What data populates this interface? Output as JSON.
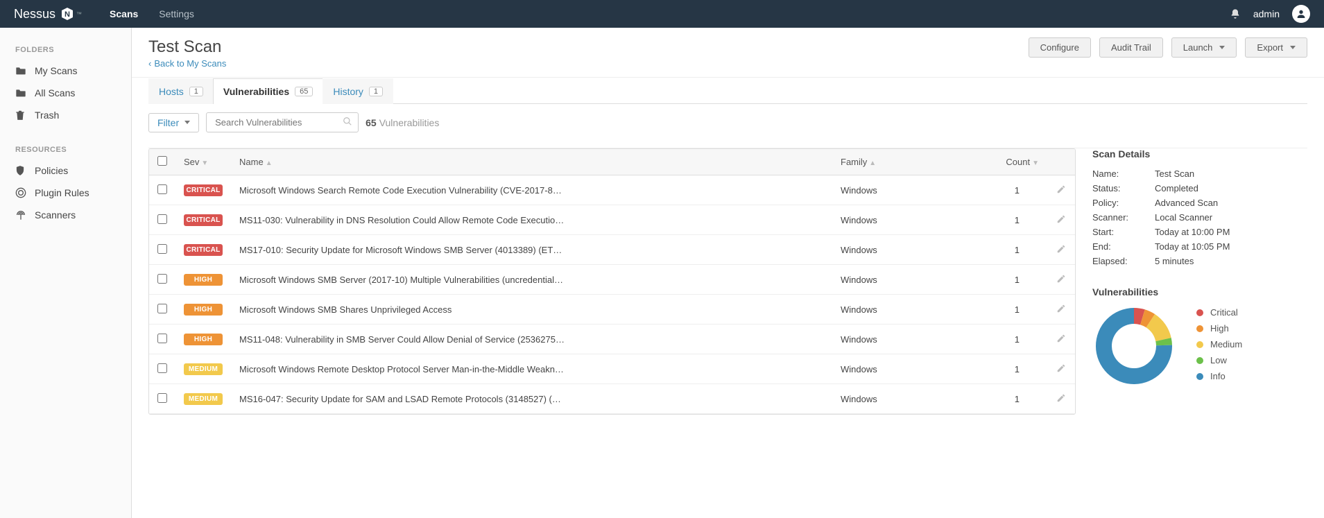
{
  "navbar": {
    "brand": "Nessus",
    "links": [
      {
        "label": "Scans",
        "active": true
      },
      {
        "label": "Settings",
        "active": false
      }
    ],
    "username": "admin"
  },
  "sidebar": {
    "folders_heading": "FOLDERS",
    "resources_heading": "RESOURCES",
    "folders": [
      {
        "label": "My Scans",
        "icon": "folder"
      },
      {
        "label": "All Scans",
        "icon": "folder"
      },
      {
        "label": "Trash",
        "icon": "trash"
      }
    ],
    "resources": [
      {
        "label": "Policies",
        "icon": "shield"
      },
      {
        "label": "Plugin Rules",
        "icon": "plugin"
      },
      {
        "label": "Scanners",
        "icon": "scanner"
      }
    ]
  },
  "page": {
    "title": "Test Scan",
    "back_label": "Back to My Scans",
    "buttons": {
      "configure": "Configure",
      "audit": "Audit Trail",
      "launch": "Launch",
      "export": "Export"
    }
  },
  "tabs": [
    {
      "label": "Hosts",
      "count": "1",
      "active": false
    },
    {
      "label": "Vulnerabilities",
      "count": "65",
      "active": true
    },
    {
      "label": "History",
      "count": "1",
      "active": false
    }
  ],
  "filters": {
    "filter_label": "Filter",
    "search_placeholder": "Search Vulnerabilities",
    "result_count_num": "65",
    "result_count_label": "Vulnerabilities"
  },
  "columns": {
    "sev": "Sev",
    "name": "Name",
    "family": "Family",
    "count": "Count"
  },
  "rows": [
    {
      "sev": "CRITICAL",
      "sev_class": "sev-critical",
      "name": "Microsoft Windows Search Remote Code Execution Vulnerability (CVE-2017-8…",
      "family": "Windows",
      "count": "1"
    },
    {
      "sev": "CRITICAL",
      "sev_class": "sev-critical",
      "name": "MS11-030: Vulnerability in DNS Resolution Could Allow Remote Code Executio…",
      "family": "Windows",
      "count": "1"
    },
    {
      "sev": "CRITICAL",
      "sev_class": "sev-critical",
      "name": "MS17-010: Security Update for Microsoft Windows SMB Server (4013389) (ET…",
      "family": "Windows",
      "count": "1"
    },
    {
      "sev": "HIGH",
      "sev_class": "sev-high",
      "name": "Microsoft Windows SMB Server (2017-10) Multiple Vulnerabilities (uncredential…",
      "family": "Windows",
      "count": "1"
    },
    {
      "sev": "HIGH",
      "sev_class": "sev-high",
      "name": "Microsoft Windows SMB Shares Unprivileged Access",
      "family": "Windows",
      "count": "1"
    },
    {
      "sev": "HIGH",
      "sev_class": "sev-high",
      "name": "MS11-048: Vulnerability in SMB Server Could Allow Denial of Service (2536275…",
      "family": "Windows",
      "count": "1"
    },
    {
      "sev": "MEDIUM",
      "sev_class": "sev-medium",
      "name": "Microsoft Windows Remote Desktop Protocol Server Man-in-the-Middle Weakn…",
      "family": "Windows",
      "count": "1"
    },
    {
      "sev": "MEDIUM",
      "sev_class": "sev-medium",
      "name": "MS16-047: Security Update for SAM and LSAD Remote Protocols (3148527) (…",
      "family": "Windows",
      "count": "1"
    }
  ],
  "details": {
    "heading": "Scan Details",
    "items": [
      {
        "label": "Name:",
        "value": "Test Scan"
      },
      {
        "label": "Status:",
        "value": "Completed"
      },
      {
        "label": "Policy:",
        "value": "Advanced Scan"
      },
      {
        "label": "Scanner:",
        "value": "Local Scanner"
      },
      {
        "label": "Start:",
        "value": "Today at 10:00 PM"
      },
      {
        "label": "End:",
        "value": "Today at 10:05 PM"
      },
      {
        "label": "Elapsed:",
        "value": "5 minutes"
      }
    ]
  },
  "vuln_chart": {
    "heading": "Vulnerabilities",
    "legend": [
      {
        "label": "Critical",
        "color": "#d9534f"
      },
      {
        "label": "High",
        "color": "#ee9336"
      },
      {
        "label": "Medium",
        "color": "#f2c94c"
      },
      {
        "label": "Low",
        "color": "#6cc04a"
      },
      {
        "label": "Info",
        "color": "#3b8bba"
      }
    ]
  },
  "chart_data": {
    "type": "pie",
    "title": "Vulnerabilities",
    "categories": [
      "Critical",
      "High",
      "Medium",
      "Low",
      "Info"
    ],
    "values": [
      3,
      3,
      8,
      2,
      49
    ],
    "colors": [
      "#d9534f",
      "#ee9336",
      "#f2c94c",
      "#6cc04a",
      "#3b8bba"
    ]
  }
}
